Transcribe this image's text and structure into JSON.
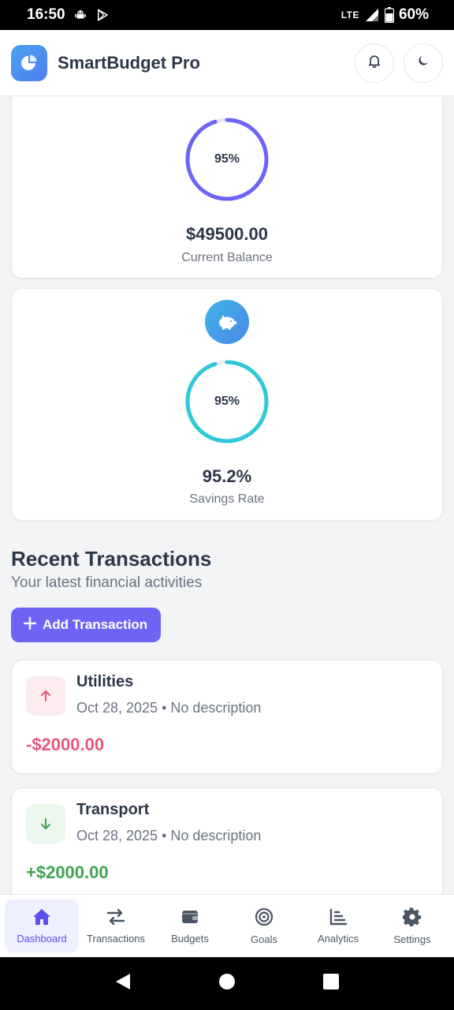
{
  "status_bar": {
    "time": "16:50",
    "network": "LTE",
    "battery": "60%"
  },
  "header": {
    "title": "SmartBudget Pro"
  },
  "stats": [
    {
      "ring_text": "95%",
      "ring_progress": 0.95,
      "value": "$49500.00",
      "label": "Current Balance",
      "color": "#6d63f5"
    },
    {
      "ring_text": "95%",
      "ring_progress": 0.95,
      "value": "95.2%",
      "label": "Savings Rate",
      "color": "#2ec8d6",
      "icon": "piggy-bank-icon"
    }
  ],
  "transactions_section": {
    "title": "Recent Transactions",
    "subtitle": "Your latest financial activities",
    "add_label": "Add Transaction"
  },
  "transactions": [
    {
      "title": "Utilities",
      "meta": "Oct 28, 2025 • No description",
      "amount": "-$2000.00",
      "direction": "expense",
      "color": "#e8577a"
    },
    {
      "title": "Transport",
      "meta": "Oct 28, 2025 • No description",
      "amount": "+$2000.00",
      "direction": "income",
      "color": "#3fa34d"
    }
  ],
  "nav": [
    {
      "label": "Dashboard",
      "icon": "home-icon",
      "active": true
    },
    {
      "label": "Transactions",
      "icon": "swap-icon",
      "active": false
    },
    {
      "label": "Budgets",
      "icon": "wallet-icon",
      "active": false
    },
    {
      "label": "Goals",
      "icon": "target-icon",
      "active": false
    },
    {
      "label": "Analytics",
      "icon": "chart-icon",
      "active": false
    },
    {
      "label": "Settings",
      "icon": "gear-icon",
      "active": false
    }
  ],
  "colors": {
    "accent": "#6d63f5",
    "expense": "#e8577a",
    "income": "#3fa34d"
  }
}
